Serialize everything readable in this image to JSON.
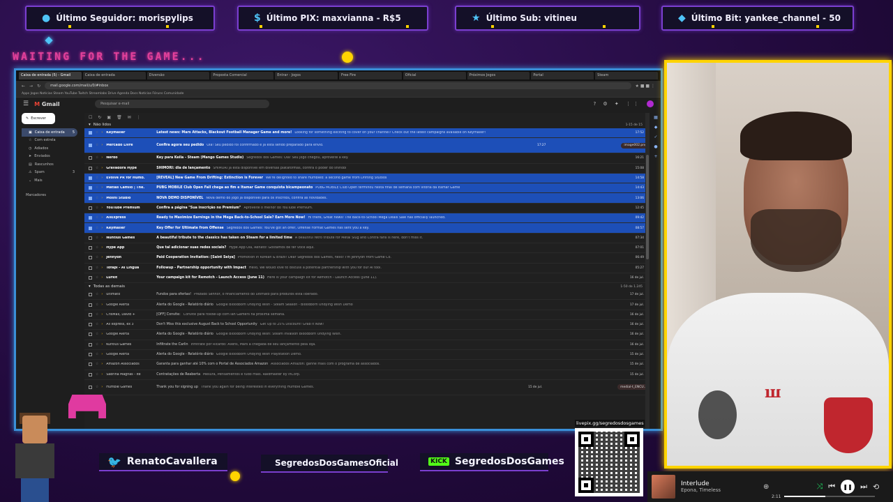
{
  "alerts": {
    "follower": "Último Seguidor: morispylips",
    "pix": "Último PIX: maxvianna - R$5",
    "sub": "Último Sub: vitineu",
    "bit": "Último Bit: yankee_channel - 50"
  },
  "waiting_text": "WAITING FOR THE GAME...",
  "browser": {
    "tabs": [
      "Caixa de entrada (5) - Gmail",
      "Caixa de entrada",
      "Diversão",
      "Proposta Comercial",
      "Entrar - Jogos",
      "Free Fire",
      "Oficial",
      "Próximos Jogos",
      "Portal",
      "Steam"
    ],
    "url": "mail.google.com/mail/u/0/#inbox",
    "bookmarks": "Apps   Jogos   Notícias   Steam   YouTube   Twitch   Streamlabs   Drive   Agenda   Docs   Notícias   Fóruns   Comunidade"
  },
  "gmail": {
    "logo": "Gmail",
    "search_placeholder": "Pesquisar e-mail",
    "compose": "Escrever",
    "sidebar": [
      {
        "label": "Caixa de entrada",
        "count": "5"
      },
      {
        "label": "Com estrela",
        "count": ""
      },
      {
        "label": "Adiados",
        "count": ""
      },
      {
        "label": "Enviados",
        "count": ""
      },
      {
        "label": "Rascunhos",
        "count": ""
      },
      {
        "label": "Spam",
        "count": "3"
      },
      {
        "label": "Mais",
        "count": ""
      }
    ],
    "labels_header": "Marcadores",
    "section_unread": "Não lidos",
    "section_unread_count": "1-15 de 15",
    "section_all": "Todas as demais",
    "section_all_count": "1-50 de 1.245",
    "unread_rows": [
      {
        "sender": "Keymailer",
        "subject": "Latest news: Mars Attacks, Blackout Football Manager Game and more!",
        "snippet": "Looking for something exciting to cover on your channel? Check out the latest campaigns available on Keymailer!",
        "time": "17:52",
        "sel": true
      },
      {
        "sender": "Mercado Livre",
        "subject": "Confira agora seu pedido",
        "snippet": "Olá! Seu pedido foi confirmado e já está sendo preparado para envio.",
        "time": "17:27",
        "sel": true,
        "attach": "image002.png"
      },
      {
        "sender": "Nerdo",
        "subject": "Key para Keila - Steam (Mango Games Studio)",
        "snippet": "Segredos dos Games: Olá! Seu jogo chegou, aproveite a key.",
        "time": "16:21",
        "sel": false
      },
      {
        "sender": "Gravadora Hype",
        "subject": "SHIMORI: dia de lançamento",
        "snippet": "SHIMORI já está disponível em diversas plataformas, confira o poder do shinobi",
        "time": "15:08",
        "sel": false
      },
      {
        "sender": "Evolve PR for Humb.",
        "subject": "[REVEAL] New Game From Drifting: Extinction is Forever",
        "snippet": "We're delighted to share Humbled: a second game from Drifting Studios",
        "time": "14:58",
        "sel": true
      },
      {
        "sender": "Matias Camilo | The.",
        "subject": "PUBG MOBILE Club Open Fall chega ao fim e Itamar Game conquista bicampeonato",
        "snippet": "PUBG MOBILE Club Open terminou nesta final de semana com vitória da Itamar Game",
        "time": "14:43",
        "sel": true
      },
      {
        "sender": "Moshi Studio",
        "subject": "NOVA DEMO DISPONÍVEL",
        "snippet": "Nova demo do jogo já disponível para os inscritos, confira as novidades.",
        "time": "13:06",
        "sel": true
      },
      {
        "sender": "YouTube Premium",
        "subject": "Confira a página \"Sua inscrição no Premium\"",
        "snippet": "Aproveite o melhor do YouTube Premium.",
        "time": "12:45",
        "sel": false
      },
      {
        "sender": "AliExpress",
        "subject": "Ready to Maximize Earnings in the Mega Back-to-School Sale? Earn More Now!",
        "snippet": "Hi there, Great news! The Back-to-School Mega Deals Sale has officially launched.",
        "time": "09:42",
        "sel": true
      },
      {
        "sender": "Keymailer",
        "subject": "Key Offer for Ultimate from Offense",
        "snippet": "Segredos dos Games: You've got an offer, Offense Format Games has sent you a key.",
        "time": "08:57",
        "sel": true
      },
      {
        "sender": "Nuntius Games",
        "subject": "A beautiful tribute to the classics has taken on Steam for a limited time",
        "snippet": "A beautiful retro tribute for Metal Slug and Contra fans is here, don't miss it.",
        "time": "07:34",
        "sel": false
      },
      {
        "sender": "Hype App",
        "subject": "Que tal adicionar suas redes sociais?",
        "snippet": "Hype App Olá, Renato! Gostamos de ter você aqui.",
        "time": "07:01",
        "sel": false
      },
      {
        "sender": "Jennydn",
        "subject": "Paid Cooperation Invitation: [Saint Seiya]",
        "snippet": "Promotion in Korean & Brazil! Dear Segredos dos Games, hello! I'm Jennydn from Game Co.",
        "time": "06:49",
        "sel": false
      },
      {
        "sender": "Tofapl - AI Lingua",
        "subject": "Followup - Partnership opportunity with Impact",
        "snippet": "Hello, We would love to discuss a potential partnership with you for our AI tool.",
        "time": "05:27",
        "sel": false
      },
      {
        "sender": "Lurkit",
        "subject": "Your campaign kit for Remotch - Launch Access (June 11)",
        "snippet": "Here is your campaign kit for Remotch - Launch Access (June 11).",
        "time": "16 de jul.",
        "sel": false
      }
    ],
    "all_rows": [
      {
        "sender": "ultimato",
        "subject": "Fundos para ofertas!",
        "snippet": "Prezado Senhor, o financiamento do ultimato para produtos está liberado.",
        "time": "17 de jul."
      },
      {
        "sender": "Google Alerta",
        "subject": "Alerta do Google - Relatório diário",
        "snippet": "Google Bloodborn Undying Wish - Steam Season - Bloodborn Undying Wish Demo",
        "time": "17 de jul."
      },
      {
        "sender": "CrisMax, David +",
        "subject": "[OFF] Convite:",
        "snippet": "Convite para follow-up com Ian Gamers na próxima semana.",
        "time": "16 de jul."
      },
      {
        "sender": "Ali express, ex 3",
        "subject": "Don't Miss this exclusive August Back to School Opportunity",
        "snippet": "Get Up to 25% Discount! Grab it Now!",
        "time": "16 de jul."
      },
      {
        "sender": "Google Alerta",
        "subject": "Alerta do Google - Relatório diário",
        "snippet": "Google Bloodborn Undying Wish: Steam invasion Bloodborn Undying Wish.",
        "time": "16 de jul."
      },
      {
        "sender": "Kuntius Games",
        "subject": "Infiltrate the Carlin",
        "snippet": "Infiltrate por Ricardo: Aliens, Mars a chegada de seu lançamento pela loja.",
        "time": "16 de jul."
      },
      {
        "sender": "Google Alerta",
        "subject": "Alerta do Google - Relatório diário",
        "snippet": "Google Bloodborn Undying Wish Playstation Demo.",
        "time": "15 de jul."
      },
      {
        "sender": "Amazon Associados",
        "subject": "Garanta para ganhar até 10% com o Portal de Associados Amazon",
        "snippet": "Associados Amazon: ganhe mais com o programa de associados.",
        "time": "15 de jul."
      },
      {
        "sender": "Sabrina Magnas - ite",
        "subject": "Contratações de Reaberta",
        "snippet": "Mesura, Pensamentos e tudo mais. Raidmaster by InCorp.",
        "time": "15 de jul."
      },
      {
        "sender": "Humble Games",
        "subject": "Thank you for signing up",
        "snippet": "Thank you again for being interested in everything Humble Games.",
        "time": "15 de jul.",
        "attach": "medial-t_ENCU..."
      }
    ]
  },
  "social": {
    "twitter": "RenatoCavallera",
    "instagram": "SegredosDosGamesOficial",
    "kick": "SegredosDosGames",
    "kick_badge": "KICK"
  },
  "qr_label": "livepix.gg/segredosdosgames",
  "player": {
    "title": "Interlude",
    "artist": "Epona, Timeless",
    "time": "2:11",
    "progress": 0.45
  },
  "colors": {
    "accent_purple": "#7b3fd0",
    "webcam_border": "#ffd400",
    "browser_border": "#3a8fd8",
    "gmail_selected": "#1d4fb8"
  }
}
